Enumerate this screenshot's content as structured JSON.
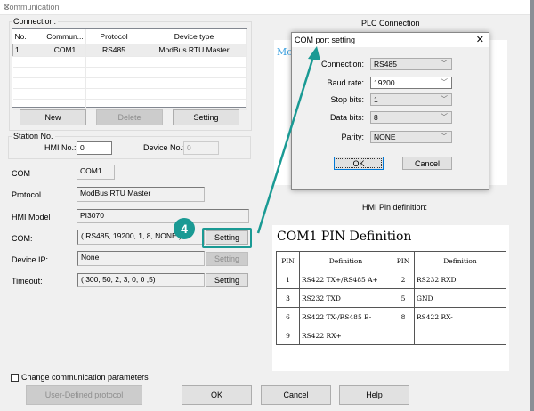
{
  "window": {
    "title": "Communication"
  },
  "connection": {
    "group_label": "Connection:",
    "columns": [
      "No.",
      "Commun...",
      "Protocol",
      "Device type"
    ],
    "rows": [
      [
        "1",
        "COM1",
        "RS485",
        "ModBus RTU Master"
      ]
    ],
    "new_label": "New",
    "delete_label": "Delete",
    "setting_label": "Setting"
  },
  "station": {
    "group_label": "Station No.",
    "hmi_label": "HMI No.:",
    "hmi_value": "0",
    "device_label": "Device No.:",
    "device_value": "0"
  },
  "form": {
    "com_label": "COM",
    "com_value": "COM1",
    "protocol_label": "Protocol",
    "protocol_value": "ModBus RTU Master",
    "model_label": "HMI Model",
    "model_value": "PI3070",
    "com2_label": "COM:",
    "com2_value": "( RS485, 19200, 1, 8, NONE )",
    "deviceip_label": "Device IP:",
    "deviceip_value": "None",
    "timeout_label": "Timeout:",
    "timeout_value": "( 300, 50, 2, 3, 0, 0 ,5)",
    "setting_label": "Setting"
  },
  "step_badge": "4",
  "accent_color": "#1a9a94",
  "bottom": {
    "checkbox_label": "Change communication parameters",
    "checkbox_checked": false,
    "user_defined_label": "User-Defined protocol",
    "ok_label": "OK",
    "cancel_label": "Cancel",
    "help_label": "Help"
  },
  "plc": {
    "label": "PLC Connection",
    "preview_text": "Moo"
  },
  "com_dialog": {
    "title": "COM port setting",
    "connection_label": "Connection:",
    "connection_value": "RS485",
    "baud_label": "Baud rate:",
    "baud_value": "19200",
    "stop_label": "Stop bits:",
    "stop_value": "1",
    "data_label": "Data bits:",
    "data_value": "8",
    "parity_label": "Parity:",
    "parity_value": "NONE",
    "ok_label": "OK",
    "cancel_label": "Cancel"
  },
  "pin": {
    "label": "HMI Pin definition:",
    "title": "COM1 PIN Definition",
    "headers": [
      "PIN",
      "Definition",
      "PIN",
      "Definition"
    ],
    "rows": [
      [
        "1",
        "RS422 TX+/RS485 A+",
        "2",
        "RS232 RXD"
      ],
      [
        "3",
        "RS232 TXD",
        "5",
        "GND"
      ],
      [
        "6",
        "RS422 TX-/RS485 B-",
        "8",
        "RS422 RX-"
      ],
      [
        "9",
        "RS422 RX+",
        "",
        ""
      ]
    ]
  }
}
